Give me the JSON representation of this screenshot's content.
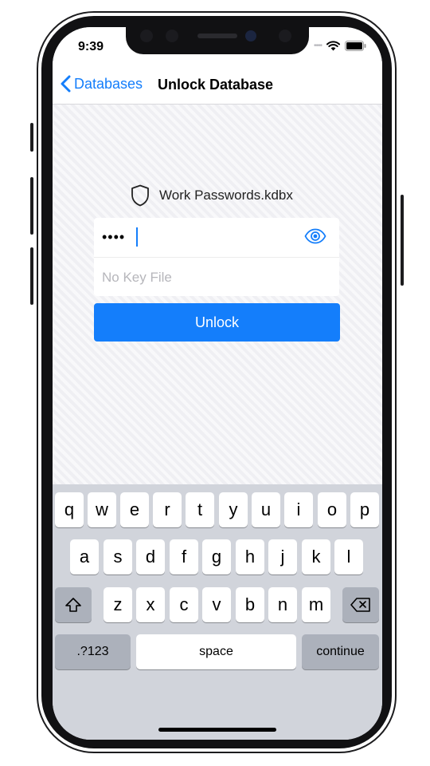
{
  "status_bar": {
    "time": "9:39",
    "signal_dots": "••••"
  },
  "nav": {
    "back_label": "Databases",
    "title": "Unlock Database"
  },
  "database": {
    "filename": "Work Passwords.kdbx"
  },
  "password_field": {
    "masked_value": "••••"
  },
  "key_file": {
    "placeholder": "No Key File"
  },
  "unlock_button": {
    "label": "Unlock"
  },
  "keyboard": {
    "row1": [
      "q",
      "w",
      "e",
      "r",
      "t",
      "y",
      "u",
      "i",
      "o",
      "p"
    ],
    "row2": [
      "a",
      "s",
      "d",
      "f",
      "g",
      "h",
      "j",
      "k",
      "l"
    ],
    "row3": [
      "z",
      "x",
      "c",
      "v",
      "b",
      "n",
      "m"
    ],
    "numbers_label": ".?123",
    "space_label": "space",
    "return_label": "continue"
  },
  "colors": {
    "accent": "#147efb",
    "keyboard_bg": "#d1d4db"
  }
}
